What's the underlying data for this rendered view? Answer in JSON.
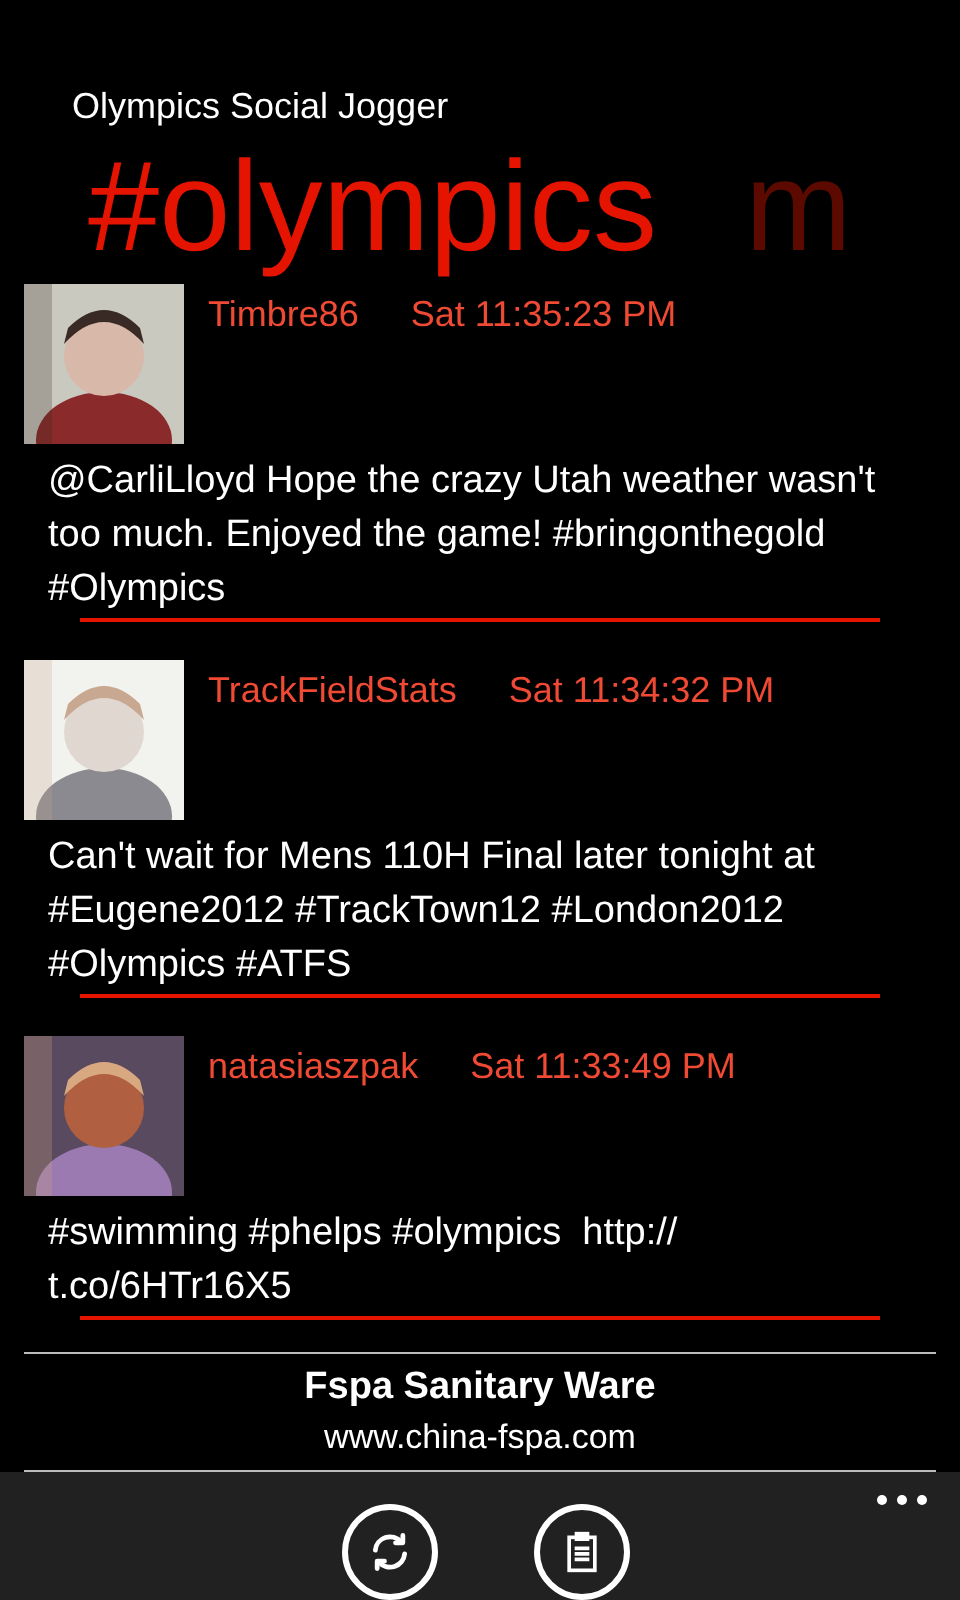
{
  "app_title": "Olympics Social Jogger",
  "pivot": [
    {
      "label": "#olympics",
      "selected": true
    },
    {
      "label": "m",
      "selected": false
    }
  ],
  "tweets": [
    {
      "user": "Timbre86",
      "time": "Sat 11:35:23 PM",
      "text": "@CarliLloyd Hope the crazy Utah weather wasn't too much. Enjoyed the game! #bringonthegold #Olympics"
    },
    {
      "user": "TrackFieldStats",
      "time": "Sat 11:34:32 PM",
      "text": "Can't wait for Mens 110H Final later tonight at #Eugene2012 #TrackTown12 #London2012 #Olympics #ATFS"
    },
    {
      "user": "natasiaszpak",
      "time": "Sat 11:33:49 PM",
      "text": "#swimming #phelps #olympics  http:// t.co/6HTr16X5"
    }
  ],
  "ad": {
    "title": "Fspa Sanitary Ware",
    "url": "www.china-fspa.com"
  },
  "app_bar": {
    "buttons": [
      {
        "kind": "refresh"
      },
      {
        "kind": "clipboard"
      }
    ]
  }
}
